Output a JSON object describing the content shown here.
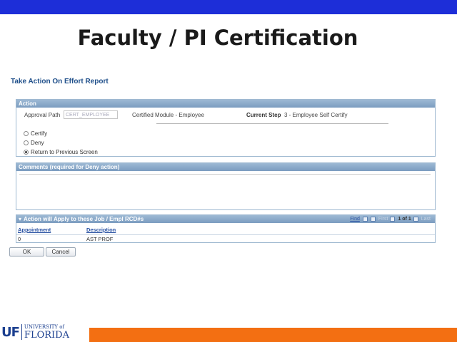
{
  "slide": {
    "title": "Faculty / PI Certification"
  },
  "page": {
    "heading": "Take Action On Effort Report"
  },
  "action": {
    "header": "Action",
    "approval_path_label": "Approval Path",
    "approval_path_value": "CERT_EMPLOYEE",
    "module_text": "Certified Module - Employee",
    "current_step_label": "Current Step",
    "current_step_value": "3 - Employee Self Certify",
    "options": [
      {
        "label": "Certify",
        "checked": false
      },
      {
        "label": "Deny",
        "checked": false
      },
      {
        "label": "Return to Previous Screen",
        "checked": true
      }
    ]
  },
  "comments": {
    "header": "Comments (required for Deny action)",
    "value": ""
  },
  "jobs": {
    "header": "Action will Apply to these Job / Empl RCD#s",
    "nav": {
      "find": "Find",
      "first": "First",
      "count": "1 of 1",
      "last": "Last"
    },
    "columns": [
      "Appointment",
      "Description"
    ],
    "rows": [
      [
        "0",
        "AST PROF"
      ]
    ]
  },
  "buttons": {
    "ok": "OK",
    "cancel": "Cancel"
  },
  "logo": {
    "short": "UF",
    "university": "UNIVERSITY of",
    "state": "FLORIDA"
  },
  "colors": {
    "top_bar": "#1d2ed8",
    "bottom_bar": "#f36f12",
    "section_header": "#8aa9c9",
    "link": "#2952a3"
  }
}
